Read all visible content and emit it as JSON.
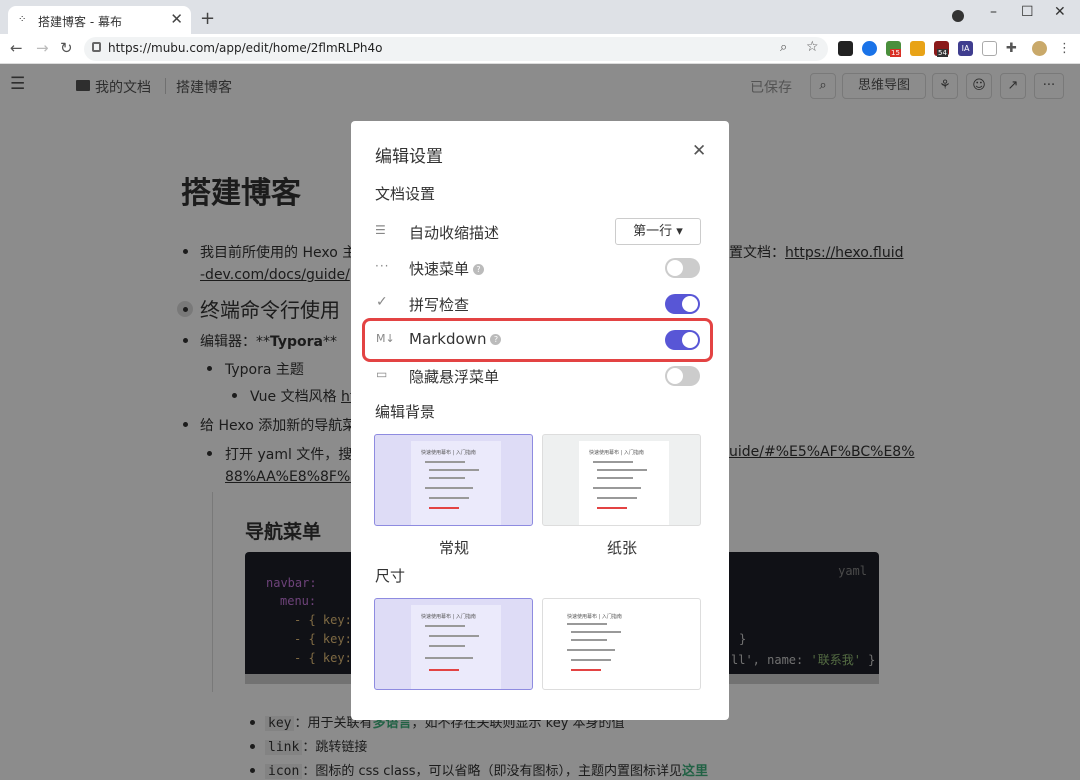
{
  "browser": {
    "tab_title": "搭建博客 - 幕布",
    "tab_favicon": "mubu-favicon",
    "url": "https://mubu.com/app/edit/home/2flmRLPh4o",
    "extension_badges": [
      "15",
      "54"
    ],
    "extension_labels": [
      "IA"
    ]
  },
  "app": {
    "breadcrumb_root": "我的文档",
    "breadcrumb_current": "搭建博客",
    "saved_status": "已保存",
    "mindmap_button": "思维导图"
  },
  "doc": {
    "title": "搭建博客",
    "l1a_pre": "我目前所使用的 Hexo 主",
    "l1a_post": "置文档：",
    "l1a_link": "https://hexo.fluid",
    "l1a_link2": "-dev.com/docs/guide/",
    "l2_heading": "终端命令行使用",
    "l3_pre": "编辑器：**",
    "l3_bold": "Typora",
    "l3_post": "**",
    "l4": "Typora 主题",
    "l5": "Vue 文档风格 ",
    "l5_link": "ht",
    "l6": "给 Hexo 添加新的导航菜",
    "l7": "打开 yaml 文件，搜",
    "l7_link_right": "uide/#%E5%AF%BC%E8%",
    "l7_link2": "88%AA%E8%8F%9C",
    "section_heading": "导航菜单",
    "code_lang": "yaml",
    "code_line1": "navbar:",
    "code_line2": "menu:",
    "code_prefix": "- { key:",
    "code_tail2": "}",
    "code_tail3_a": "ll', name: ",
    "code_tail3_b": "'联系我'",
    "code_tail3_c": " }",
    "bullet_key_code": "key",
    "bullet_key_text": "：用于关联有",
    "bullet_key_green": "多语言",
    "bullet_key_rest": "，如不存在关联则显示 key 本身的值",
    "bullet_link_code": "link",
    "bullet_link_text": "：跳转链接",
    "bullet_icon_code": "icon",
    "bullet_icon_text": "：图标的 css class，可以省略（即没有图标），主题内置图标详见",
    "bullet_icon_link": "这里"
  },
  "modal": {
    "title": "编辑设置",
    "section_doc": "文档设置",
    "auto_collapse_label": "自动收缩描述",
    "auto_collapse_value": "第一行 ▾",
    "quick_menu_label": "快速菜单",
    "spell_check_label": "拼写检查",
    "markdown_label": "Markdown",
    "hide_float_label": "隐藏悬浮菜单",
    "section_bg": "编辑背景",
    "bg_normal": "常规",
    "bg_paper": "纸张",
    "section_size": "尺寸",
    "help_glyph": "?",
    "toggles": {
      "quick_menu": false,
      "spell_check": true,
      "markdown": true,
      "hide_float": false
    },
    "thumb_title": "快速使用幕布 | 入门指南"
  },
  "colors": {
    "accent": "#5856d6",
    "highlight": "#e34343",
    "overlay": "rgba(0,0,0,0.45)",
    "code_bg": "#1e2029",
    "green": "#3fb27f"
  }
}
